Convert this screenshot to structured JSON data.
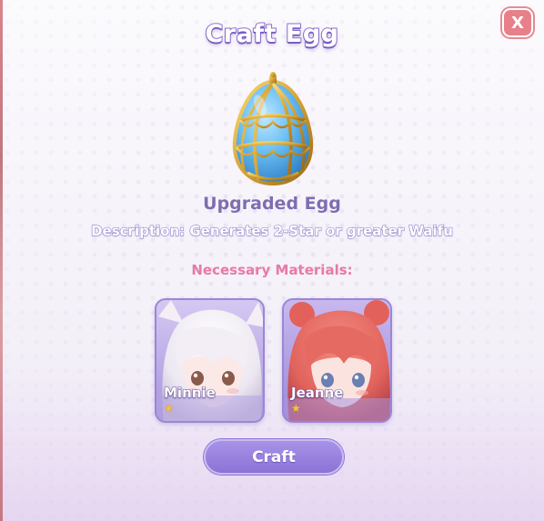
{
  "dialog": {
    "title": "Craft Egg",
    "close_label": "X"
  },
  "item": {
    "name": "Upgraded Egg",
    "description": "Description: Generates 2-Star or greater Waifu",
    "egg_icon": "ornate-blue-gold-egg"
  },
  "materials": {
    "label": "Necessary Materials:",
    "cards": [
      {
        "name": "Minnie",
        "stars": 1,
        "star_icon": "star-icon",
        "hair_color": "#f2eef4"
      },
      {
        "name": "Jeanne",
        "stars": 1,
        "star_icon": "star-icon",
        "hair_color": "#e4665e"
      }
    ]
  },
  "actions": {
    "craft_label": "Craft"
  },
  "colors": {
    "accent": "#8e6fd1",
    "close_button": "#e8808a",
    "materials_label": "#e77aa8",
    "star": "#f4c53d"
  }
}
